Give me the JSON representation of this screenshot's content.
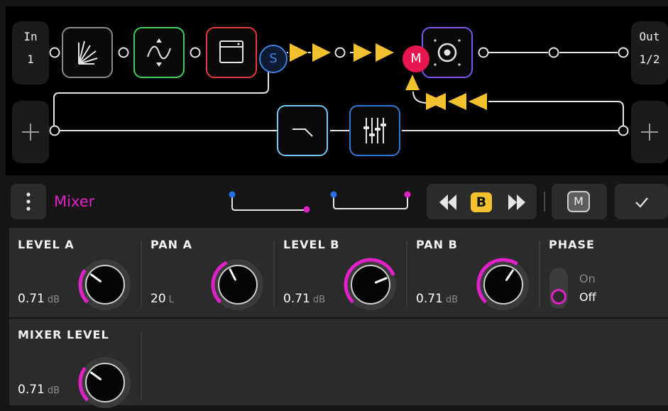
{
  "grid": {
    "input": {
      "label": "In",
      "channel": "1"
    },
    "output": {
      "label": "Out",
      "channel": "1/2"
    },
    "split": {
      "label": "S"
    },
    "merge": {
      "label": "M"
    },
    "colors": {
      "arrow": "#f2c12e",
      "merge": "#e8164f",
      "split": "#3d82e0"
    },
    "blocks": [
      {
        "name": "multi-delay-block",
        "icon": "fan-delay-icon",
        "border": "#8a8a8a"
      },
      {
        "name": "modulation-block",
        "icon": "sine-wave-icon",
        "border": "#3ed05a"
      },
      {
        "name": "amp-block",
        "icon": "amp-icon",
        "border": "#e03a3a"
      },
      {
        "name": "cab-block",
        "icon": "speaker-icon",
        "border": "#7a55e8"
      },
      {
        "name": "filter-block",
        "icon": "lowpass-filter-icon",
        "border": "#7ac4f0"
      },
      {
        "name": "mixer-block",
        "icon": "mixer-faders-icon",
        "border": "#2e7ad8"
      }
    ]
  },
  "toolbar": {
    "block_title": "Mixer",
    "ab_selected": "B",
    "mode_badge": "M",
    "title_color": "#e020c8",
    "icons": [
      "more-vertical-icon",
      "snapshot-routing-icon",
      "snapshot-routing-icon",
      "prev-icon",
      "next-icon",
      "checkmark-icon"
    ]
  },
  "params": [
    {
      "id": "level-a",
      "label": "LEVEL A",
      "value": "0.71",
      "unit": "dB",
      "knob_fraction": 0.3
    },
    {
      "id": "pan-a",
      "label": "PAN A",
      "value": "20",
      "unit": "L",
      "knob_fraction": 0.4
    },
    {
      "id": "level-b",
      "label": "LEVEL B",
      "value": "0.71",
      "unit": "dB",
      "knob_fraction": 0.75
    },
    {
      "id": "pan-b",
      "label": "PAN B",
      "value": "0.71",
      "unit": "dB",
      "knob_fraction": 0.625
    },
    {
      "id": "mixer-level",
      "label": "MIXER LEVEL",
      "value": "0.71",
      "unit": "dB",
      "knob_fraction": 0.3
    }
  ],
  "phase": {
    "label": "PHASE",
    "on_label": "On",
    "off_label": "Off",
    "selected": "Off"
  }
}
